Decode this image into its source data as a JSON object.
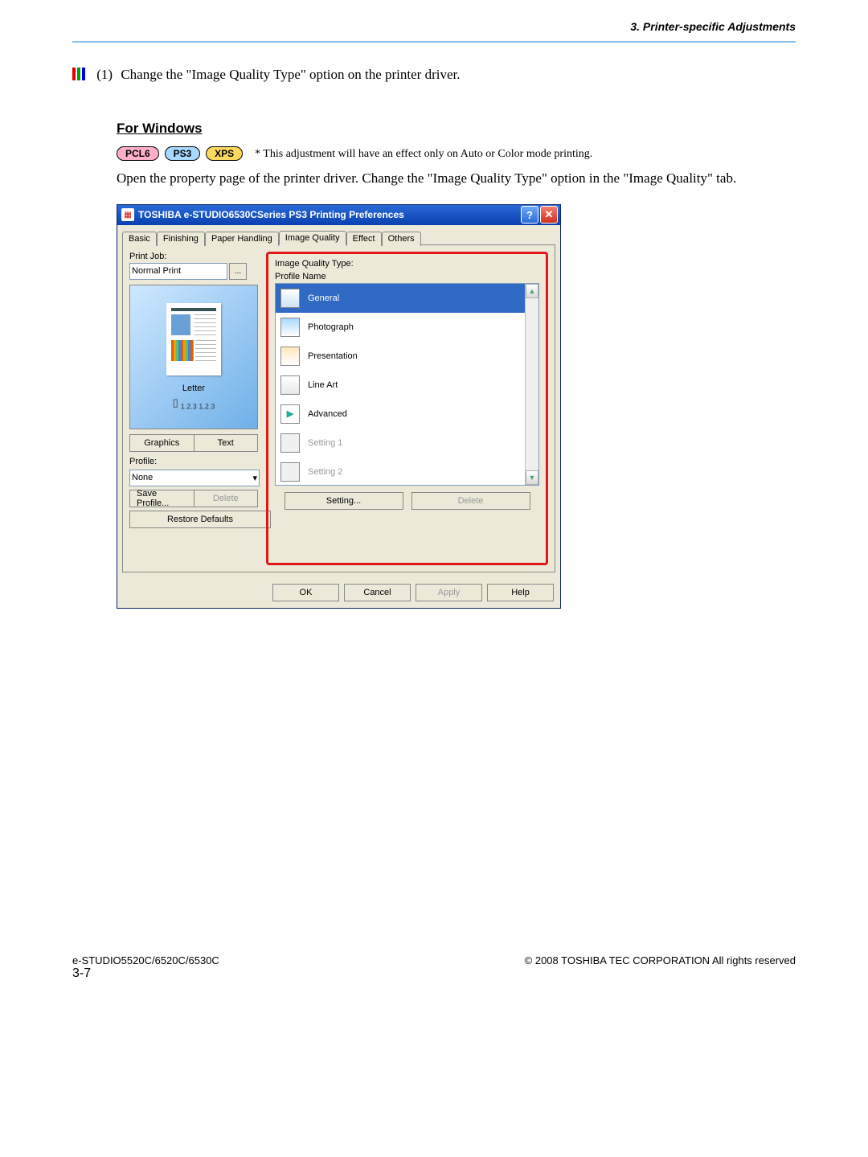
{
  "header": {
    "section_title": "3. Printer-specific Adjustments"
  },
  "step": {
    "marker_bars": [
      "#e00000",
      "#00a000",
      "#0000e0"
    ],
    "number": "(1)",
    "text": "Change the \"Image Quality Type\" option on the printer driver."
  },
  "sub_heading": "For Windows",
  "badges": {
    "pcl6": "PCL6",
    "ps3": "PS3",
    "xps": "XPS"
  },
  "note": "* This adjustment will have an effect only on Auto or Color mode printing.",
  "paragraph": "Open the property page of the printer driver.  Change the \"Image Quality Type\" option in the \"Image Quality\" tab.",
  "dialog": {
    "title": "TOSHIBA e-STUDIO6530CSeries PS3 Printing Preferences",
    "tabs": [
      "Basic",
      "Finishing",
      "Paper Handling",
      "Image Quality",
      "Effect",
      "Others"
    ],
    "active_tab_index": 3,
    "left": {
      "print_job_label": "Print Job:",
      "print_job_value": "Normal Print",
      "preview_label": "Letter",
      "preview_pages": "1.2.3     1.2.3",
      "graphics_btn": "Graphics",
      "text_btn": "Text",
      "profile_label": "Profile:",
      "profile_value": "None",
      "save_profile_btn": "Save Profile...",
      "delete_btn": "Delete",
      "restore_btn": "Restore Defaults"
    },
    "right": {
      "iq_type_label": "Image Quality Type:",
      "profile_name_label": "Profile Name",
      "items": [
        {
          "label": "General",
          "icon": "gen",
          "selected": true
        },
        {
          "label": "Photograph",
          "icon": "photo"
        },
        {
          "label": "Presentation",
          "icon": "pres"
        },
        {
          "label": "Line Art",
          "icon": "line"
        },
        {
          "label": "Advanced",
          "icon": "adv"
        },
        {
          "label": "Setting 1",
          "icon": "set",
          "disabled": true
        },
        {
          "label": "Setting 2",
          "icon": "set",
          "disabled": true
        }
      ],
      "setting_btn": "Setting...",
      "delete_btn": "Delete"
    },
    "footer": {
      "ok": "OK",
      "cancel": "Cancel",
      "apply": "Apply",
      "help": "Help"
    }
  },
  "footer": {
    "left": "e-STUDIO5520C/6520C/6530C",
    "right": "© 2008 TOSHIBA TEC CORPORATION All rights reserved",
    "page_no": "3-7"
  }
}
